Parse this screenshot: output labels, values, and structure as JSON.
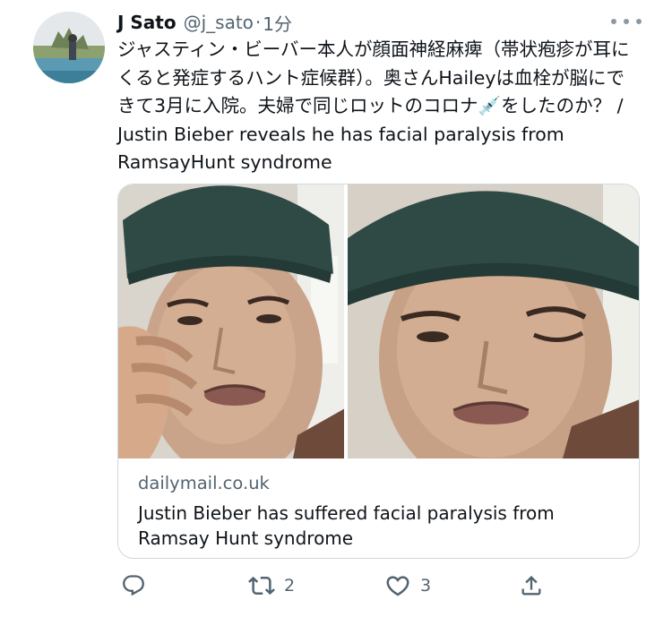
{
  "tweet": {
    "display_name": "J Sato",
    "handle": "@j_sato",
    "separator": "·",
    "timestamp": "1分",
    "more_icon": "more-dots-icon",
    "text": "ジャスティン・ビーバー本人が顔面神経麻痺（帯状疱疹が耳にくると発症するハント症候群）。奥さんHaileyは血栓が脳にできて3月に入院。夫婦で同じロットのコロナ💉をしたのか？ / Justin Bieber reveals he has facial paralysis from RamsayHunt syndrome"
  },
  "card": {
    "domain": "dailymail.co.uk",
    "title": "Justin Bieber has suffered facial paralysis from Ramsay Hunt syndrome",
    "images": [
      "left-photo",
      "right-photo"
    ]
  },
  "actions": {
    "reply": {
      "icon": "reply-icon",
      "count": ""
    },
    "retweet": {
      "icon": "retweet-icon",
      "count": "2"
    },
    "like": {
      "icon": "heart-icon",
      "count": "3"
    },
    "share": {
      "icon": "share-icon",
      "count": ""
    }
  },
  "colors": {
    "text_primary": "#0f1419",
    "text_secondary": "#536471",
    "border": "#cfd9de"
  }
}
